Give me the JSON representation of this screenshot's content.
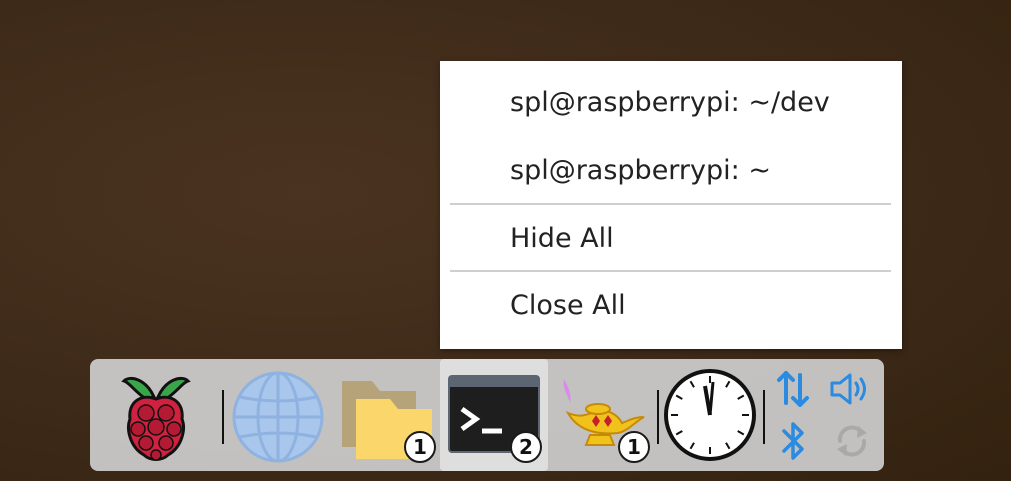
{
  "context_menu": {
    "items": [
      {
        "label": "spl@raspberrypi: ~/dev"
      },
      {
        "label": "spl@raspberrypi: ~"
      },
      {
        "label": "Hide All"
      },
      {
        "label": "Close All"
      }
    ]
  },
  "taskbar": {
    "apps": [
      {
        "name": "Raspberry Pi menu",
        "icon": "raspberry-icon"
      },
      {
        "name": "Web browser",
        "icon": "globe-icon"
      },
      {
        "name": "File manager",
        "icon": "folder-icon",
        "badge": "1"
      },
      {
        "name": "Terminal",
        "icon": "terminal-icon",
        "badge": "2"
      },
      {
        "name": "Python lamp",
        "icon": "lamp-icon",
        "badge": "1"
      },
      {
        "name": "Clock",
        "icon": "clock-icon"
      }
    ],
    "tray": [
      "network-arrows-icon",
      "volume-icon",
      "bluetooth-icon",
      "sync-icon"
    ]
  },
  "colors": {
    "desktop_bg": "#3e2a19",
    "taskbar_bg": "#cdcdcd",
    "tray_blue": "#2a8be0"
  }
}
